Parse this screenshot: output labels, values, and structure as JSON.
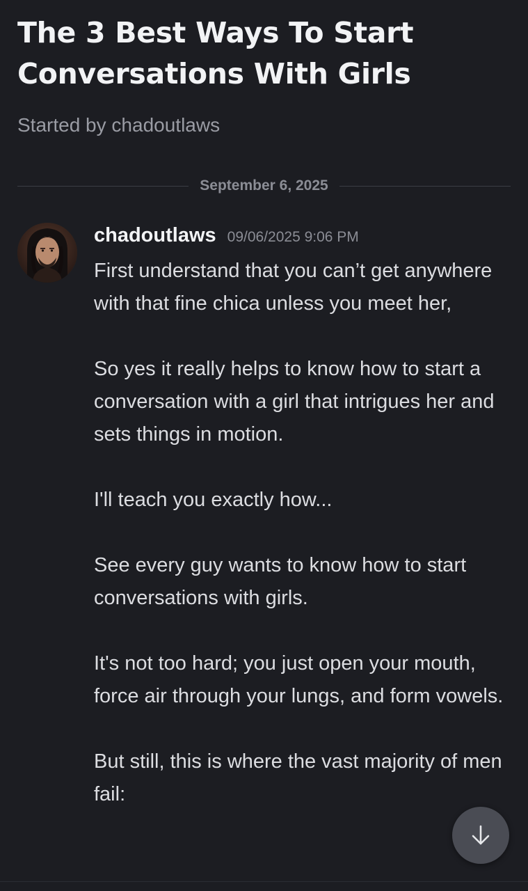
{
  "thread": {
    "title": "The 3 Best Ways To Start Conversations With Girls",
    "started_by_prefix": "Started by",
    "started_by_author": "chadoutlaws"
  },
  "divider": {
    "date": "September 6, 2025"
  },
  "message": {
    "author": "chadoutlaws",
    "timestamp": "09/06/2025 9:06 PM",
    "paragraphs": [
      "First understand that you can’t get anywhere with that fine chica unless you meet her,",
      "So yes it really helps to know how to start a conversation with a girl that intrigues her and sets things in motion.",
      "I'll teach you exactly how...",
      "See every guy wants to know how to start conversations with girls.",
      "It's not too hard; you just open your mouth, force air through your lungs, and form vowels.",
      "But still, this is where the vast majority of men fail:"
    ]
  },
  "icons": {
    "avatar": "avatar-portrait",
    "scroll_down": "arrow-down-icon"
  },
  "colors": {
    "background": "#1c1d22",
    "title": "#f2f3f5",
    "body_text": "#dcdde1",
    "muted": "#8b8d95",
    "scroll_button": "#4a4c54"
  }
}
